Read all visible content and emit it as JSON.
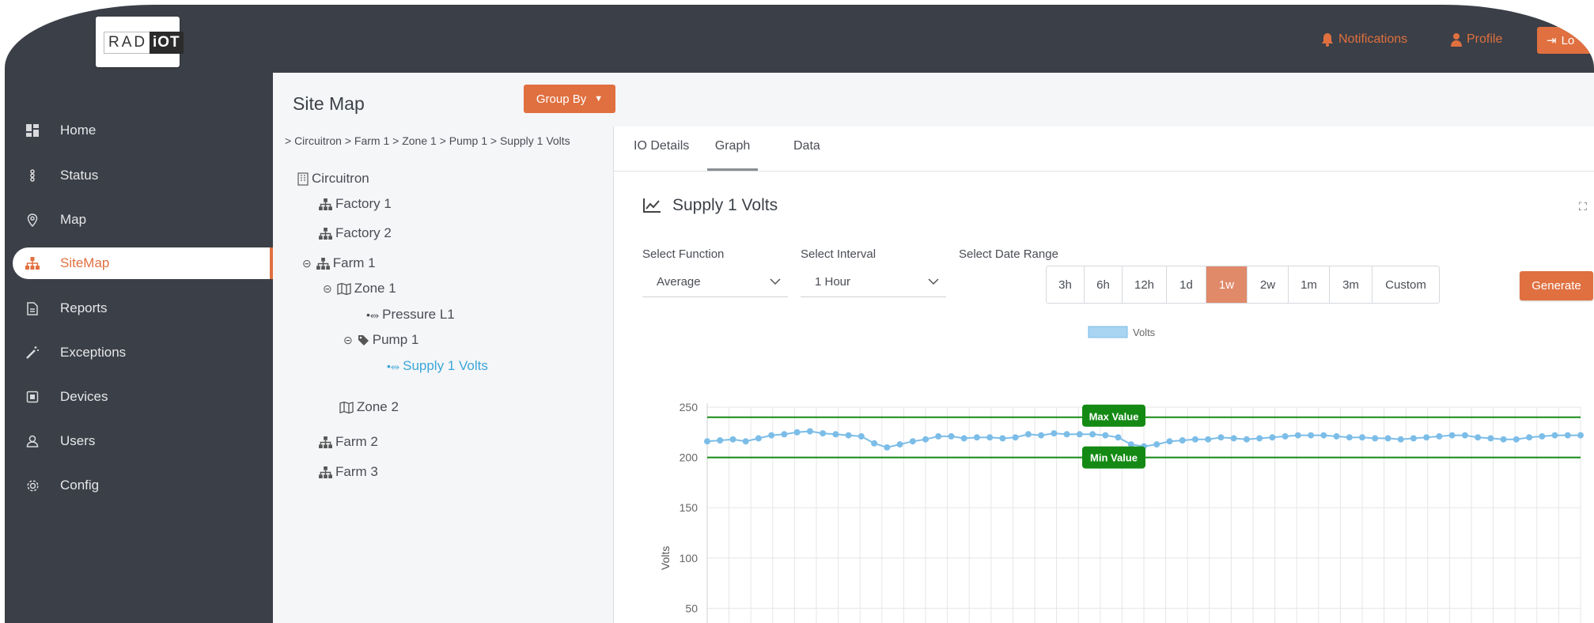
{
  "logo": {
    "rad": "RAD",
    "iot": "iOT"
  },
  "topbar": {
    "notifications": "Notifications",
    "profile": "Profile",
    "logout": "Lo"
  },
  "sidebar": {
    "items": [
      {
        "label": "Home",
        "icon": "dashboard-icon"
      },
      {
        "label": "Status",
        "icon": "status-icon"
      },
      {
        "label": "Map",
        "icon": "map-pin-icon"
      },
      {
        "label": "SiteMap",
        "icon": "sitemap-icon",
        "active": true
      },
      {
        "label": "Reports",
        "icon": "report-icon"
      },
      {
        "label": "Exceptions",
        "icon": "magic-wand-icon"
      },
      {
        "label": "Devices",
        "icon": "device-icon"
      },
      {
        "label": "Users",
        "icon": "user-icon"
      },
      {
        "label": "Config",
        "icon": "gear-icon"
      }
    ]
  },
  "sitemap": {
    "title": "Site Map",
    "group_by": "Group By",
    "breadcrumb": "> Circuitron > Farm 1 > Zone 1 > Pump 1 > Supply 1 Volts",
    "tree": [
      {
        "label": "Circuitron",
        "icon": "building-icon"
      },
      {
        "label": "Factory 1",
        "icon": "sitemap-icon"
      },
      {
        "label": "Factory 2",
        "icon": "sitemap-icon"
      },
      {
        "label": "Farm 1",
        "icon": "sitemap-icon",
        "toggle": "⊝"
      },
      {
        "label": "Zone 1",
        "icon": "map-icon",
        "toggle": "⊝"
      },
      {
        "label": "Pressure L1",
        "icon": "usb-icon"
      },
      {
        "label": "Pump 1",
        "icon": "tag-icon",
        "toggle": "⊝"
      },
      {
        "label": "Supply 1 Volts",
        "icon": "usb-icon",
        "selected": true
      },
      {
        "label": "Zone 2",
        "icon": "map-icon"
      },
      {
        "label": "Farm 2",
        "icon": "sitemap-icon"
      },
      {
        "label": "Farm 3",
        "icon": "sitemap-icon"
      }
    ]
  },
  "tabs": [
    {
      "label": "IO Details"
    },
    {
      "label": "Graph",
      "active": true
    },
    {
      "label": "Data"
    }
  ],
  "panel": {
    "title": "Supply 1 Volts",
    "select_function_label": "Select Function",
    "select_function_value": "Average",
    "select_interval_label": "Select Interval",
    "select_interval_value": "1 Hour",
    "date_range_label": "Select Date Range",
    "ranges": [
      "3h",
      "6h",
      "12h",
      "1d",
      "1w",
      "2w",
      "1m",
      "3m",
      "Custom"
    ],
    "active_range": "1w",
    "generate": "Generate"
  },
  "colors": {
    "accent": "#e07040",
    "sidebar": "#3b3f47",
    "series": "#7cbde8",
    "limit": "#148a14"
  },
  "chart_data": {
    "type": "line",
    "legend": "Volts",
    "ylabel": "Volts",
    "ylim": [
      0,
      250
    ],
    "yticks": [
      50,
      100,
      150,
      200,
      250
    ],
    "max_label": "Max Value",
    "max_value": 240,
    "min_label": "Min Value",
    "min_value": 200,
    "grid": true,
    "series": [
      {
        "name": "Volts",
        "values": [
          216,
          217,
          218,
          216,
          219,
          222,
          223,
          225,
          226,
          224,
          223,
          222,
          221,
          214,
          210,
          213,
          216,
          218,
          221,
          221,
          219,
          220,
          220,
          219,
          220,
          223,
          222,
          224,
          223,
          223,
          223,
          222,
          220,
          213,
          211,
          213,
          216,
          217,
          218,
          218,
          220,
          219,
          218,
          219,
          220,
          221,
          222,
          222,
          222,
          221,
          220,
          220,
          219,
          219,
          218,
          219,
          220,
          221,
          222,
          222,
          220,
          219,
          218,
          218,
          220,
          221,
          222,
          222,
          222
        ]
      }
    ]
  }
}
